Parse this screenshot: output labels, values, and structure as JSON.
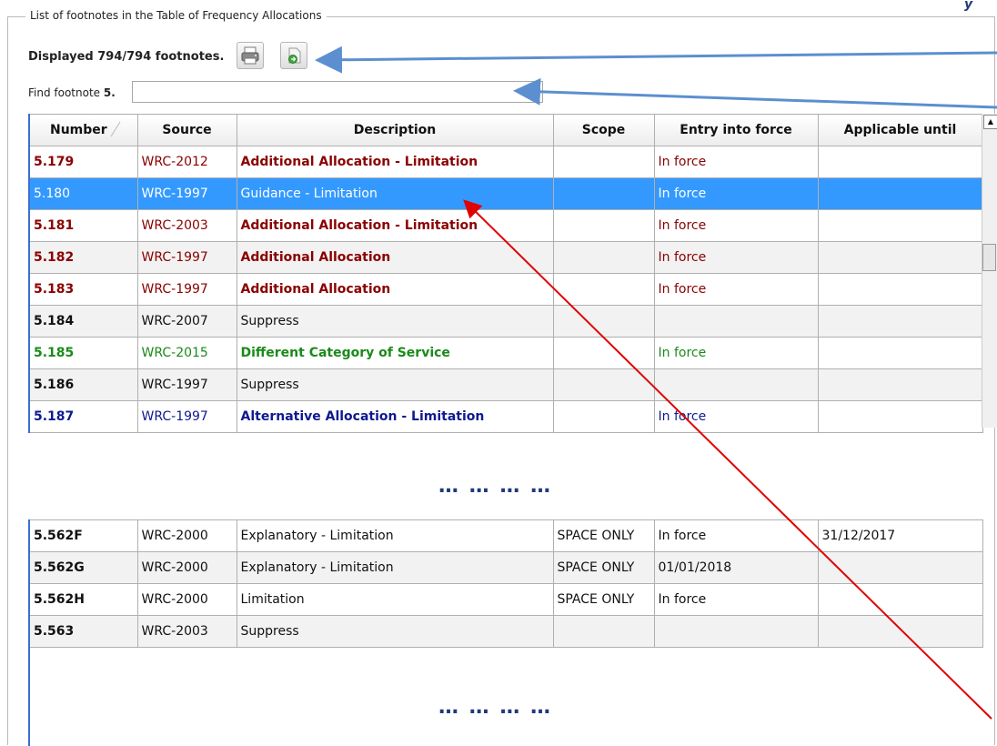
{
  "window": {
    "groupbox_title": "List of footnotes in the Table of Frequency Allocations"
  },
  "toolbar": {
    "count_text": "Displayed 794/794 footnotes.",
    "print_icon": "printer-icon",
    "export_icon": "export-icon"
  },
  "find": {
    "label": "Find footnote",
    "prefix": "5.",
    "value": "",
    "placeholder": ""
  },
  "table": {
    "columns": [
      "Number",
      "Source",
      "Description",
      "Scope",
      "Entry into force",
      "Applicable until"
    ],
    "rows_top": [
      {
        "number": "5.179",
        "source": "WRC-2012",
        "description": "Additional Allocation - Limitation",
        "scope": "",
        "entry": "In force",
        "until": "",
        "color": "dark",
        "desc_bold": true,
        "selected": false
      },
      {
        "number": "5.180",
        "source": "WRC-1997",
        "description": "Guidance - Limitation",
        "scope": "",
        "entry": "In force",
        "until": "",
        "color": "black",
        "desc_bold": false,
        "selected": true
      },
      {
        "number": "5.181",
        "source": "WRC-2003",
        "description": "Additional Allocation - Limitation",
        "scope": "",
        "entry": "In force",
        "until": "",
        "color": "dark",
        "desc_bold": true,
        "selected": false
      },
      {
        "number": "5.182",
        "source": "WRC-1997",
        "description": "Additional Allocation",
        "scope": "",
        "entry": "In force",
        "until": "",
        "color": "dark",
        "desc_bold": true,
        "selected": false
      },
      {
        "number": "5.183",
        "source": "WRC-1997",
        "description": "Additional Allocation",
        "scope": "",
        "entry": "In force",
        "until": "",
        "color": "dark",
        "desc_bold": true,
        "selected": false
      },
      {
        "number": "5.184",
        "source": "WRC-2007",
        "description": "Suppress",
        "scope": "",
        "entry": "",
        "until": "",
        "color": "black",
        "desc_bold": false,
        "selected": false
      },
      {
        "number": "5.185",
        "source": "WRC-2015",
        "description": "Different Category of Service",
        "scope": "",
        "entry": "In force",
        "until": "",
        "color": "green",
        "desc_bold": true,
        "selected": false
      },
      {
        "number": "5.186",
        "source": "WRC-1997",
        "description": "Suppress",
        "scope": "",
        "entry": "",
        "until": "",
        "color": "black",
        "desc_bold": false,
        "selected": false
      },
      {
        "number": "5.187",
        "source": "WRC-1997",
        "description": "Alternative Allocation - Limitation",
        "scope": "",
        "entry": "In force",
        "until": "",
        "color": "blue",
        "desc_bold": true,
        "selected": false
      }
    ],
    "rows_bottom": [
      {
        "number": "5.562F",
        "source": "WRC-2000",
        "description": "Explanatory - Limitation",
        "scope": "SPACE ONLY",
        "entry": "In force",
        "until": "31/12/2017",
        "color": "black",
        "desc_bold": false
      },
      {
        "number": "5.562G",
        "source": "WRC-2000",
        "description": "Explanatory - Limitation",
        "scope": "SPACE ONLY",
        "entry": "01/01/2018",
        "until": "",
        "color": "black",
        "desc_bold": false
      },
      {
        "number": "5.562H",
        "source": "WRC-2000",
        "description": "Limitation",
        "scope": "SPACE ONLY",
        "entry": "In force",
        "until": "",
        "color": "black",
        "desc_bold": false
      },
      {
        "number": "5.563",
        "source": "WRC-2003",
        "description": "Suppress",
        "scope": "",
        "entry": "",
        "until": "",
        "color": "black",
        "desc_bold": false
      }
    ]
  },
  "ellipsis": "… … … …",
  "colors": {
    "selection": "#3399ff",
    "dark_red": "#8b0000",
    "green": "#1a8a1a",
    "blue": "#0e1a8f",
    "arrow_blue": "#5b8fd0",
    "arrow_red": "#e00000"
  }
}
